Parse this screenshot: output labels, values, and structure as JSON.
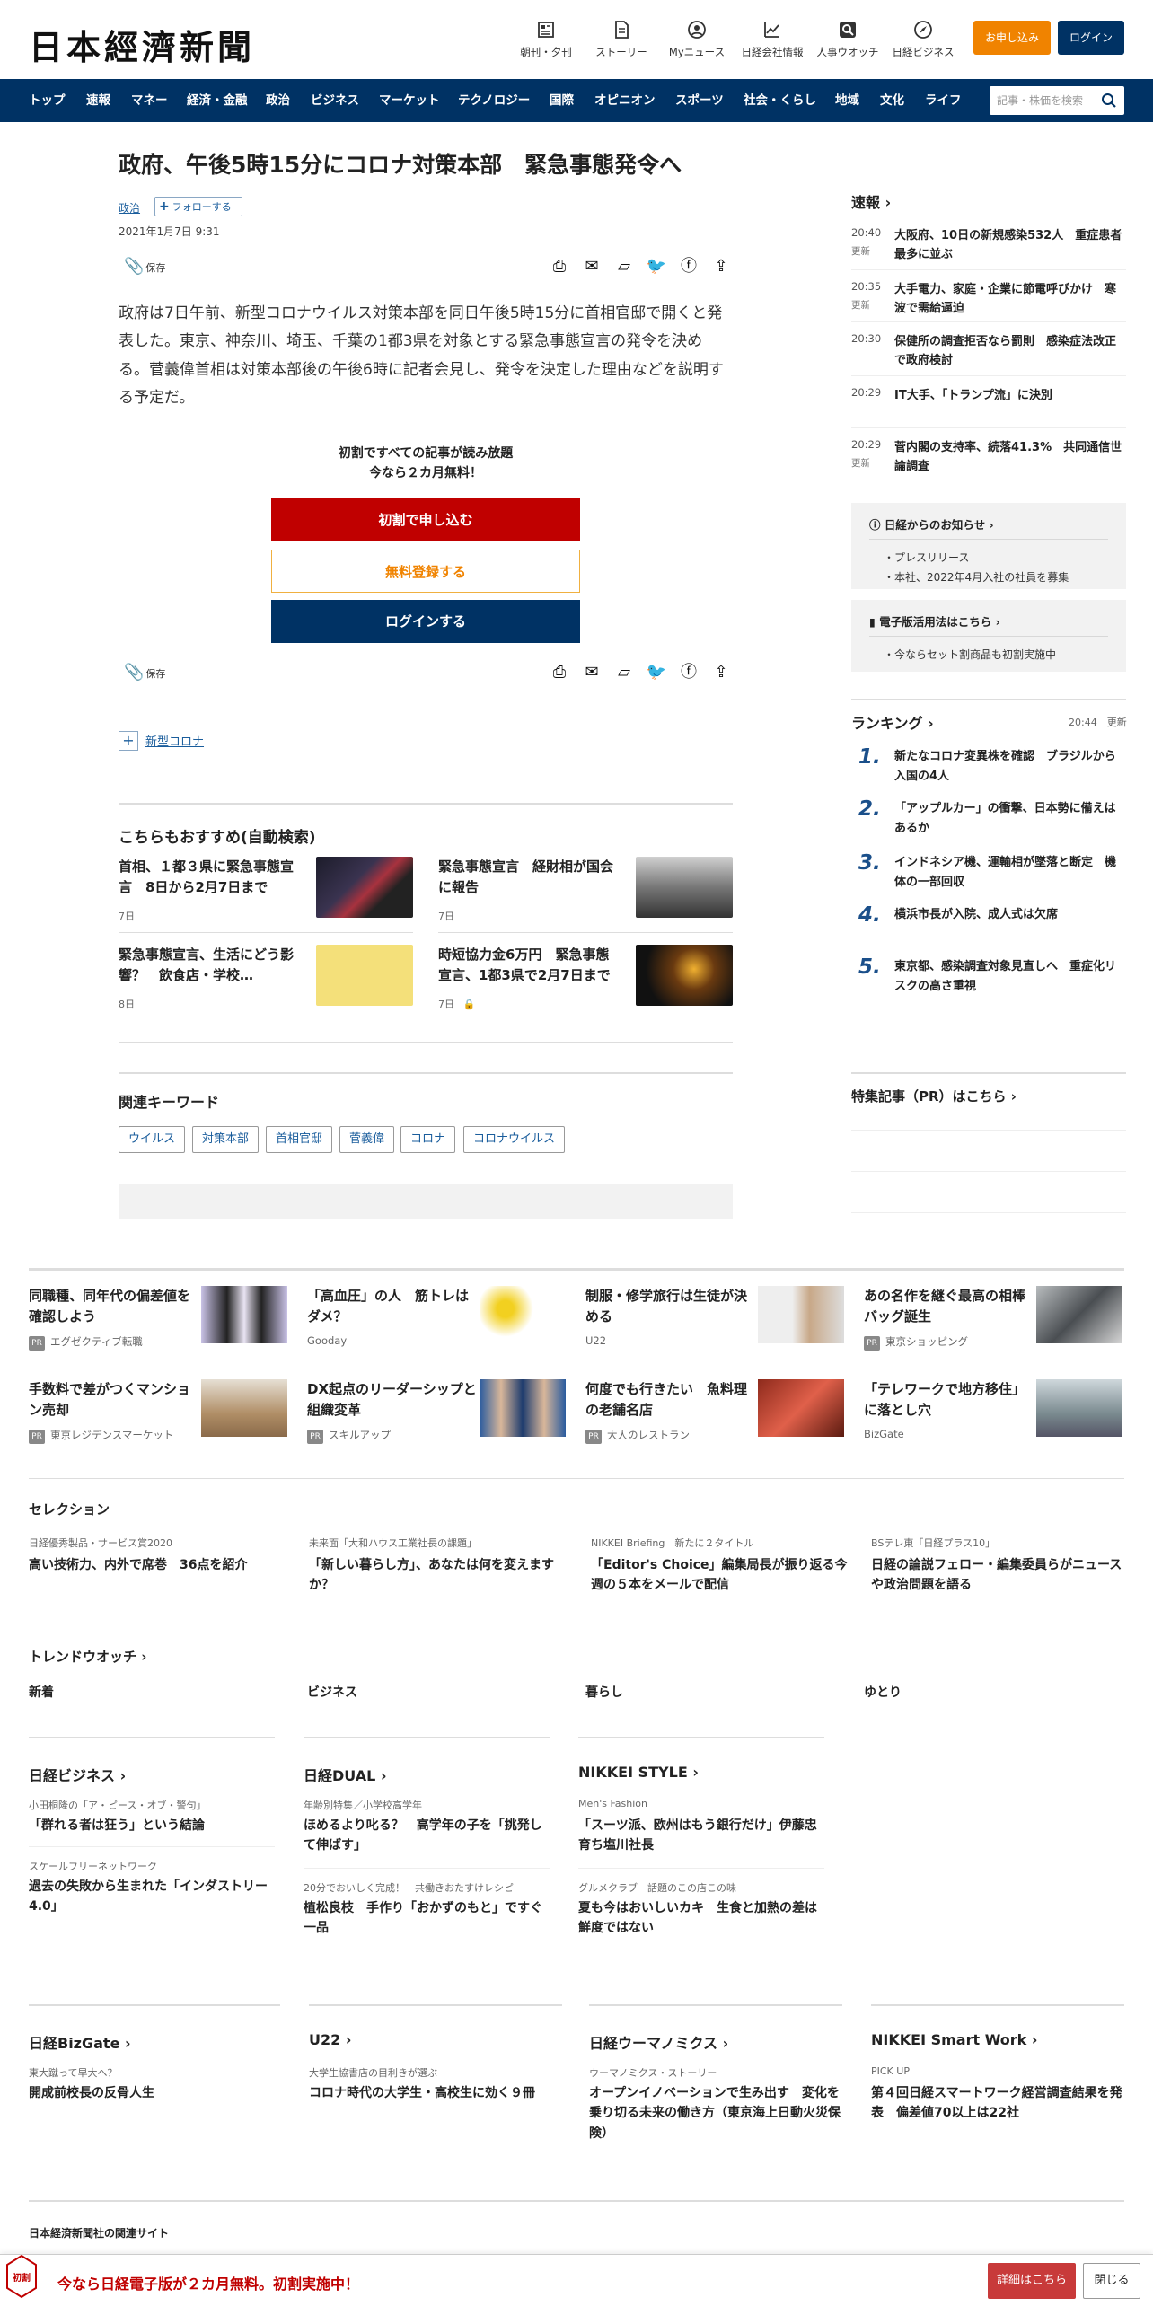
{
  "header": {
    "logo": "日本經濟新聞",
    "icons": [
      {
        "label": "朝刊・夕刊",
        "icon": "newspaper-icon"
      },
      {
        "label": "ストーリー",
        "icon": "document-icon"
      },
      {
        "label": "Myニュース",
        "icon": "person-icon"
      },
      {
        "label": "日経会社情報",
        "icon": "chart-icon"
      },
      {
        "label": "人事ウオッチ",
        "icon": "search-icon"
      },
      {
        "label": "日経ビジネス",
        "icon": "compass-icon"
      }
    ],
    "apply_label": "お申し込み",
    "login_label": "ログイン"
  },
  "nav": {
    "items": [
      "トップ",
      "速報",
      "マネー",
      "経済・金融",
      "政治",
      "ビジネス",
      "マーケット",
      "テクノロジー",
      "国際",
      "オピニオン",
      "スポーツ",
      "社会・くらし",
      "地域",
      "文化",
      "ライフ"
    ],
    "search_placeholder": "記事・株価を検索"
  },
  "article": {
    "title": "政府、午後5時15分にコロナ対策本部　緊急事態発令へ",
    "category": "政治",
    "follow_label": "フォローする",
    "date": "2021年1月7日 9:31",
    "save_label": "保存",
    "lead": "政府は7日午前、新型コロナウイルス対策本部を同日午後5時15分に首相官邸で開くと発表した。東京、神奈川、埼玉、千葉の1都3県を対象とする緊急事態宣言の発令を決める。菅義偉首相は対策本部後の午後6時に記者会見し、発令を決定した理由などを説明する予定だ。",
    "promo_line1": "初割ですべての記事が読み放題",
    "promo_line2": "今なら２カ月無料！",
    "btn_signup": "初割で申し込む",
    "btn_free": "無料登録する",
    "btn_login": "ログインする",
    "topic": "新型コロナ"
  },
  "recommend": {
    "title": "こちらもおすすめ(自動検索)",
    "items": [
      {
        "title": "首相、１都３県に緊急事態宣言　8日から2月7日まで",
        "date": "7日"
      },
      {
        "title": "緊急事態宣言　経財相が国会に報告",
        "date": "7日"
      },
      {
        "title": "緊急事態宣言、生活にどう影響？　飲食店・学校…",
        "date": "8日"
      },
      {
        "title": "時短協力金6万円　緊急事態宣言、1都3県で2月7日まで",
        "date": "7日"
      }
    ]
  },
  "keywords": {
    "title": "関連キーワード",
    "items": [
      "ウイルス",
      "対策本部",
      "首相官邸",
      "菅義偉",
      "コロナ",
      "コロナウイルス"
    ]
  },
  "sidebar": {
    "flash_title": "速報",
    "flash": [
      {
        "time": "20:40",
        "upd": "更新",
        "text": "大阪府、10日の新規感染532人　重症患者最多に並ぶ"
      },
      {
        "time": "20:35",
        "upd": "更新",
        "text": "大手電力、家庭・企業に節電呼びかけ　寒波で需給逼迫"
      },
      {
        "time": "20:30",
        "upd": "",
        "text": "保健所の調査拒否なら罰則　感染症法改正で政府検討"
      },
      {
        "time": "20:29",
        "upd": "",
        "text": "IT大手、「トランプ流」に決別"
      },
      {
        "time": "20:29",
        "upd": "更新",
        "text": "菅内閣の支持率、続落41.3%　共同通信世論調査"
      }
    ],
    "notice_title": "日経からのお知らせ",
    "notice_items": [
      "プレスリリース",
      "本社、2022年4月入社の社員を募集"
    ],
    "guide_title": "電子版活用法はこちら",
    "guide_items": [
      "今ならセット割商品も初割実施中"
    ],
    "ranking_title": "ランキング",
    "ranking_time": "20:44　更新",
    "ranking": [
      {
        "no": "1.",
        "text": "新たなコロナ変異株を確認　ブラジルから入国の4人"
      },
      {
        "no": "2.",
        "text": "「アップルカー」の衝撃、日本勢に備えはあるか"
      },
      {
        "no": "3.",
        "text": "インドネシア機、運輸相が墜落と断定　機体の一部回収"
      },
      {
        "no": "4.",
        "text": "横浜市長が入院、成人式は欠席"
      },
      {
        "no": "5.",
        "text": "東京都、感染調査対象見直しへ　重症化リスクの高さ重視"
      }
    ],
    "pr_title": "特集記事（PR）はこちら"
  },
  "ads": [
    {
      "title": "同職種、同年代の偏差値を確認しよう",
      "source": "エグゼクティブ転職",
      "pr": true
    },
    {
      "title": "「高血圧」の人　筋トレはダメ？",
      "source": "Gooday",
      "pr": false
    },
    {
      "title": "制服・修学旅行は生徒が決める",
      "source": "U22",
      "pr": false
    },
    {
      "title": "あの名作を継ぐ最高の相棒バッグ誕生",
      "source": "東京ショッピング",
      "pr": true
    },
    {
      "title": "手数料で差がつくマンション売却",
      "source": "東京レジデンスマーケット",
      "pr": true
    },
    {
      "title": "DX起点のリーダーシップと組織変革",
      "source": "スキルアップ",
      "pr": true
    },
    {
      "title": "何度でも行きたい　魚料理の老舗名店",
      "source": "大人のレストラン",
      "pr": true
    },
    {
      "title": "「テレワークで地方移住」に落とし穴",
      "source": "BizGate",
      "pr": false
    }
  ],
  "selection": {
    "title": "セレクション",
    "items": [
      {
        "sub": "日経優秀製品・サービス賞2020",
        "text": "高い技術力、内外で席巻　36点を紹介"
      },
      {
        "sub": "未来面「大和ハウス工業社長の課題」",
        "text": "「新しい暮らし方」、あなたは何を変えますか？"
      },
      {
        "sub": "NIKKEI Briefing　新たに２タイトル",
        "text": "「Editor's Choice」編集局長が振り返る今週の５本をメールで配信"
      },
      {
        "sub": "BSテレ東「日経プラス10」",
        "text": "日経の論説フェロー・編集委員らがニュースや政治問題を語る"
      }
    ]
  },
  "trend": {
    "title": "トレンドウオッチ",
    "tabs": [
      "新着",
      "ビジネス",
      "暮らし",
      "ゆとり"
    ]
  },
  "blocks1": [
    {
      "title": "日経ビジネス",
      "items": [
        {
          "sub": "小田桐隆の「ア・ピース・オブ・警句」",
          "text": "「群れる者は狂う」という結論"
        },
        {
          "sub": "スケールフリーネットワーク",
          "text": "過去の失敗から生まれた「インダストリー4.0」"
        }
      ]
    },
    {
      "title": "日経DUAL",
      "items": [
        {
          "sub": "年齢別特集／小学校高学年",
          "text": "ほめるより叱る？　高学年の子を「挑発して伸ばす」"
        },
        {
          "sub": "20分でおいしく完成！　共働きおたすけレシピ",
          "text": "植松良枝　手作り「おかずのもと」ですぐ一品"
        }
      ]
    },
    {
      "title": "NIKKEI STYLE",
      "items": [
        {
          "sub": "Men's Fashion",
          "text": "「スーツ派、欧州はもう銀行だけ」伊藤忠 育ち塩川社長"
        },
        {
          "sub": "グルメクラブ　話題のこの店この味",
          "text": "夏も今はおいしいカキ　生食と加熱の差は鮮度ではない"
        }
      ]
    }
  ],
  "blocks2": [
    {
      "title": "日経BizGate",
      "sub": "東大蹴って早大へ？",
      "text": "開成前校長の反骨人生"
    },
    {
      "title": "U22",
      "sub": "大学生協書店の目利きが選ぶ",
      "text": "コロナ時代の大学生・高校生に効く９冊"
    },
    {
      "title": "日経ウーマノミクス",
      "sub": "ウーマノミクス・ストーリー",
      "text": "オープンイノベーションで生み出す　変化を乗り切る未来の働き方（東京海上日動火災保険）"
    },
    {
      "title": "NIKKEI Smart Work",
      "sub": "PICK UP",
      "text": "第４回日経スマートワーク経営調査結果を発表　偏差値70以上は22社"
    }
  ],
  "footer": {
    "related": "日本経済新聞社の関連サイト",
    "bar_text": "今なら日経電子版が２カ月無料。初割実施中！",
    "badge": "初割",
    "detail_label": "詳細はこちら",
    "close_label": "閉じる"
  },
  "colors": {
    "navy": "#003264",
    "orange": "#f08300",
    "red": "#c00000",
    "link": "#1a5d9c"
  }
}
